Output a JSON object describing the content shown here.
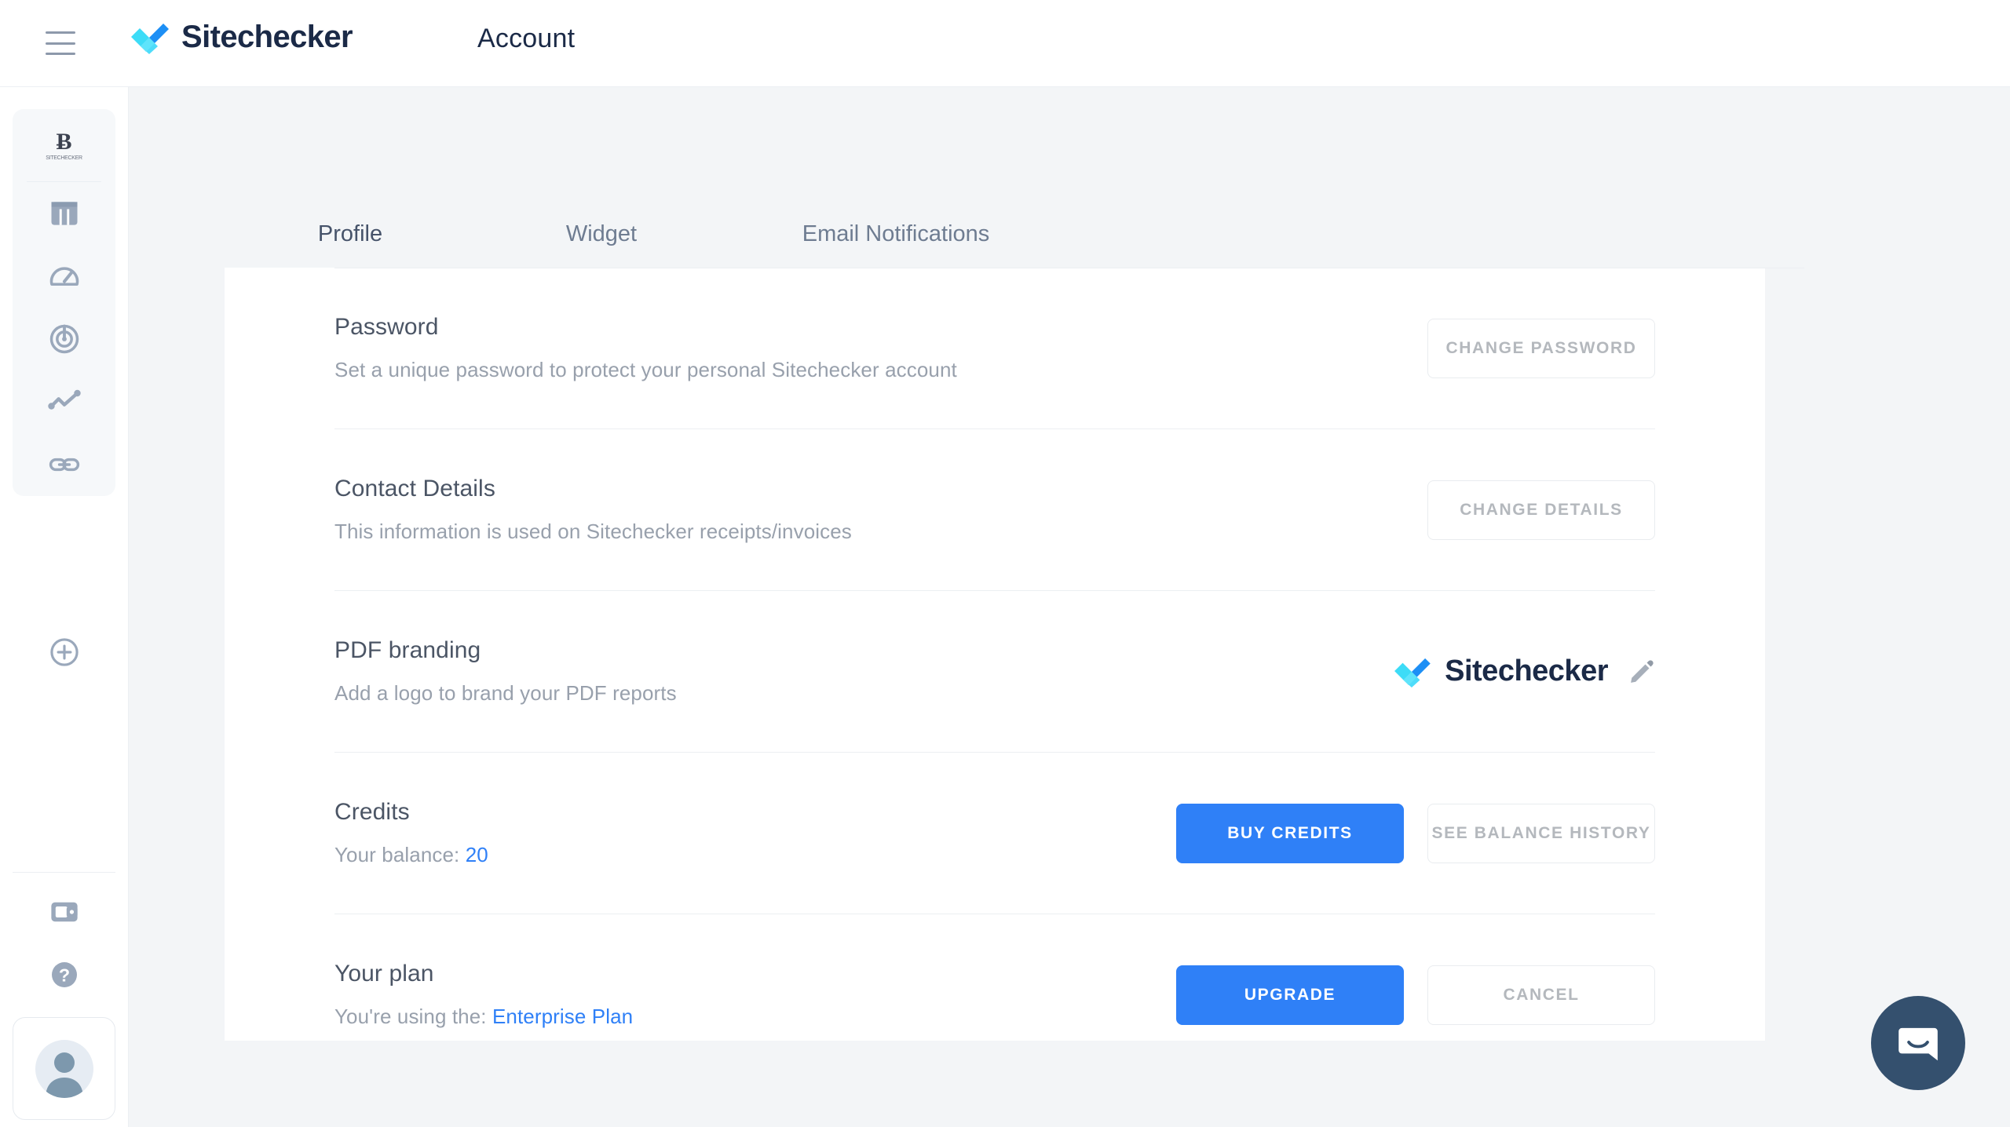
{
  "topbar": {
    "menu_icon": "hamburger-menu-icon",
    "brand_name": "Sitechecker",
    "page_title": "Account"
  },
  "sidebar": {
    "top_items": [
      {
        "icon": "site-favicon-icon",
        "glyph": "Ƀ",
        "sublabel": "SITECHECKER"
      },
      {
        "icon": "dashboard-columns-icon"
      },
      {
        "icon": "speedometer-gauge-icon"
      },
      {
        "icon": "radar-target-icon"
      },
      {
        "icon": "trending-line-icon"
      },
      {
        "icon": "link-chain-icon"
      }
    ],
    "add_project": {
      "icon": "plus-circle-icon"
    },
    "bottom_items": [
      {
        "icon": "wallet-billing-icon"
      },
      {
        "icon": "help-question-icon"
      }
    ],
    "avatar": {
      "icon": "user-avatar-icon"
    }
  },
  "tabs": [
    {
      "id": "profile",
      "label": "Profile",
      "active": true
    },
    {
      "id": "widget",
      "label": "Widget",
      "active": false
    },
    {
      "id": "email-notifications",
      "label": "Email Notifications",
      "active": false
    }
  ],
  "sections": {
    "password": {
      "title": "Password",
      "subtitle": "Set a unique password to protect your personal Sitechecker account",
      "button": "CHANGE PASSWORD"
    },
    "contact": {
      "title": "Contact Details",
      "subtitle": "This information is used on Sitechecker receipts/invoices",
      "button": "CHANGE DETAILS"
    },
    "pdf": {
      "title": "PDF branding",
      "subtitle": "Add a logo to brand your PDF reports",
      "logo_name": "Sitechecker",
      "edit_icon": "pencil-edit-icon"
    },
    "credits": {
      "title": "Credits",
      "balance_label": "Your balance:",
      "balance_value": "20",
      "primary_button": "BUY CREDITS",
      "secondary_button": "SEE BALANCE HISTORY"
    },
    "plan": {
      "title": "Your plan",
      "using_label": "You're using the:",
      "plan_name": "Enterprise Plan",
      "primary_button": "UPGRADE",
      "secondary_button": "CANCEL"
    }
  },
  "chat": {
    "icon": "intercom-chat-bubble-icon"
  },
  "colors": {
    "accent_blue": "#2f80f7",
    "brand_navy": "#1b2a47",
    "logo_cyan": "#3ddcf7",
    "logo_blue": "#1d8ff5",
    "chat_navy": "#34506e",
    "tab_active_underline": "#2e4463"
  }
}
